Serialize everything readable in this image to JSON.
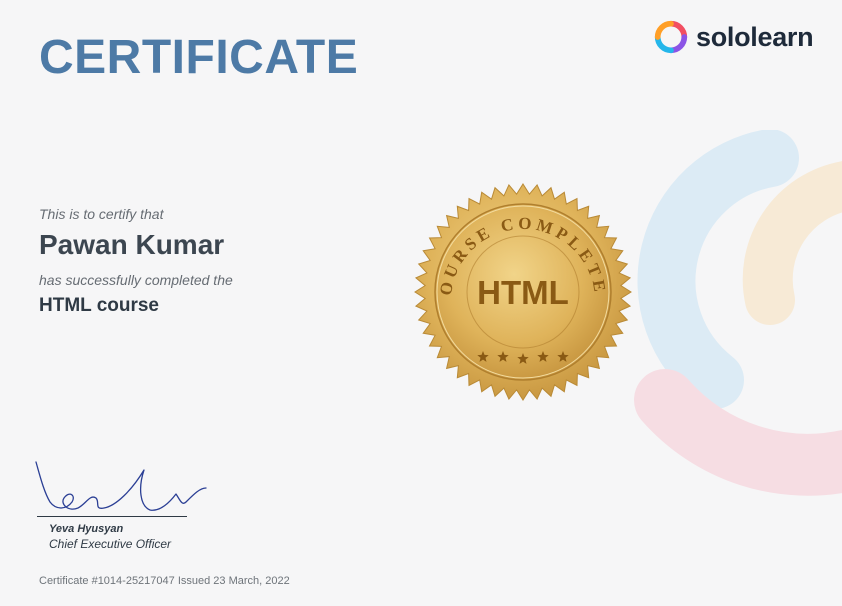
{
  "certificate": {
    "title": "CERTIFICATE",
    "intro_text": "This is to certify that",
    "recipient_name": "Pawan Kumar",
    "completion_text": "has successfully completed the",
    "course_name": "HTML course"
  },
  "brand": {
    "name": "sololearn",
    "logo_icon": "sololearn-logo-icon",
    "logo_colors": [
      "#f24f62",
      "#ff9f27",
      "#24b6ea",
      "#8b54e6"
    ]
  },
  "seal": {
    "arc_text": "COURSE COMPLETED",
    "label": "HTML",
    "stars": 5
  },
  "signatory": {
    "name": "Yeva Hyusyan",
    "title": "Chief Executive Officer"
  },
  "footer": {
    "certificate_info": "Certificate #1014-25217047 Issued 23 March, 2022"
  },
  "colors": {
    "title": "#4d7aa6",
    "background": "#f6f6f7",
    "seal_gold": "#d9ac4f",
    "seal_text": "#8a5a14",
    "deco_blue": "#dcebf5",
    "deco_orange": "#f7ead6",
    "deco_pink": "#f6dde3"
  }
}
